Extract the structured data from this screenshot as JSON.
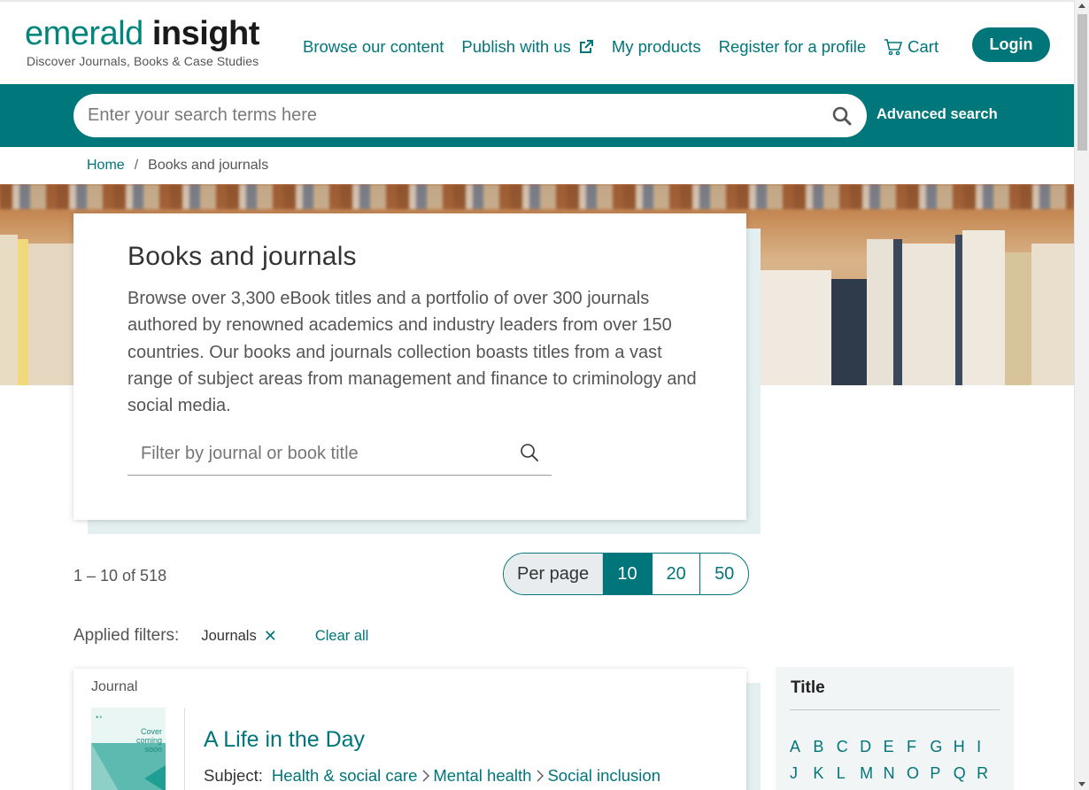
{
  "header": {
    "logo_light": "emerald",
    "logo_bold": "insight",
    "tagline": "Discover Journals, Books & Case Studies",
    "nav": [
      {
        "label": "Browse our content"
      },
      {
        "label": "Publish with us",
        "icon": "external-link-icon"
      },
      {
        "label": "My products"
      },
      {
        "label": "Register for a profile"
      },
      {
        "label": "Cart",
        "icon": "cart-icon"
      }
    ],
    "login_label": "Login"
  },
  "search": {
    "placeholder": "Enter your search terms here",
    "advanced_label": "Advanced search"
  },
  "breadcrumb": {
    "home": "Home",
    "separator": "/",
    "current": "Books and journals"
  },
  "intro": {
    "title": "Books and journals",
    "description": "Browse over 3,300 eBook titles and a portfolio of over 300 journals authored by renowned academics and industry leaders from over 150 countries. Our books and journals collection boasts titles from a vast range of subject areas from management and finance to criminology and social media.",
    "filter_placeholder": "Filter by journal or book title"
  },
  "results": {
    "count_text": "1 – 10 of 518",
    "per_page_label": "Per page",
    "per_page_options": [
      "10",
      "20",
      "50"
    ],
    "per_page_selected": "10"
  },
  "filters": {
    "label": "Applied filters:",
    "chips": [
      {
        "label": "Journals"
      }
    ],
    "clear_label": "Clear all"
  },
  "items": [
    {
      "type": "Journal",
      "cover_text": "Cover coming soon",
      "title": "A Life in the Day",
      "subject_label": "Subject:",
      "subjects": [
        "Health & social care",
        "Mental health",
        "Social inclusion"
      ]
    }
  ],
  "sidebar": {
    "title": "Title",
    "letters": [
      "A",
      "B",
      "C",
      "D",
      "E",
      "F",
      "G",
      "H",
      "I",
      "J",
      "K",
      "L",
      "M",
      "N",
      "O",
      "P",
      "Q",
      "R"
    ]
  },
  "colors": {
    "brand": "#00757a",
    "search_bar": "#00777a"
  }
}
